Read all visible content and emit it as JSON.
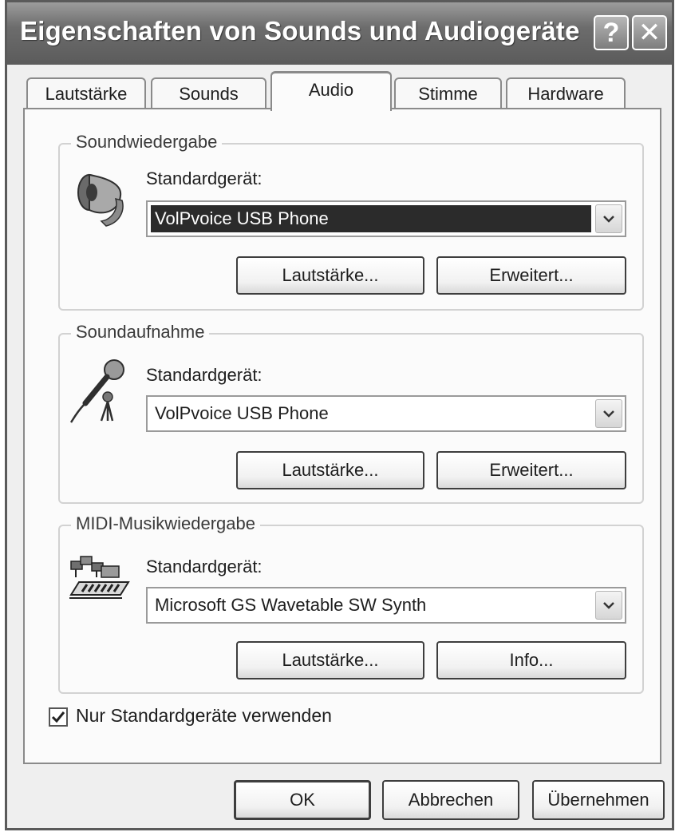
{
  "window": {
    "title": "Eigenschaften von Sounds und Audiogeräte",
    "help_glyph": "?",
    "close_glyph": "✕"
  },
  "tabs": [
    {
      "label": "Lautstärke",
      "active": false
    },
    {
      "label": "Sounds",
      "active": false
    },
    {
      "label": "Audio",
      "active": true
    },
    {
      "label": "Stimme",
      "active": false
    },
    {
      "label": "Hardware",
      "active": false
    }
  ],
  "playback": {
    "group_label": "Soundwiedergabe",
    "device_label": "Standardgerät:",
    "device_value": "VolPvoice USB Phone",
    "volume_button": "Lautstärke...",
    "advanced_button": "Erweitert...",
    "icon": "speaker-icon"
  },
  "recording": {
    "group_label": "Soundaufnahme",
    "device_label": "Standardgerät:",
    "device_value": "VolPvoice USB Phone",
    "volume_button": "Lautstärke...",
    "advanced_button": "Erweitert...",
    "icon": "microphone-icon"
  },
  "midi": {
    "group_label": "MIDI-Musikwiedergabe",
    "device_label": "Standardgerät:",
    "device_value": "Microsoft GS Wavetable SW Synth",
    "volume_button": "Lautstärke...",
    "info_button": "Info...",
    "icon": "midi-keyboard-icon"
  },
  "only_default_devices": {
    "label": "Nur Standardgeräte verwenden",
    "checked": true
  },
  "footer": {
    "ok": "OK",
    "cancel": "Abbrechen",
    "apply": "Übernehmen"
  }
}
